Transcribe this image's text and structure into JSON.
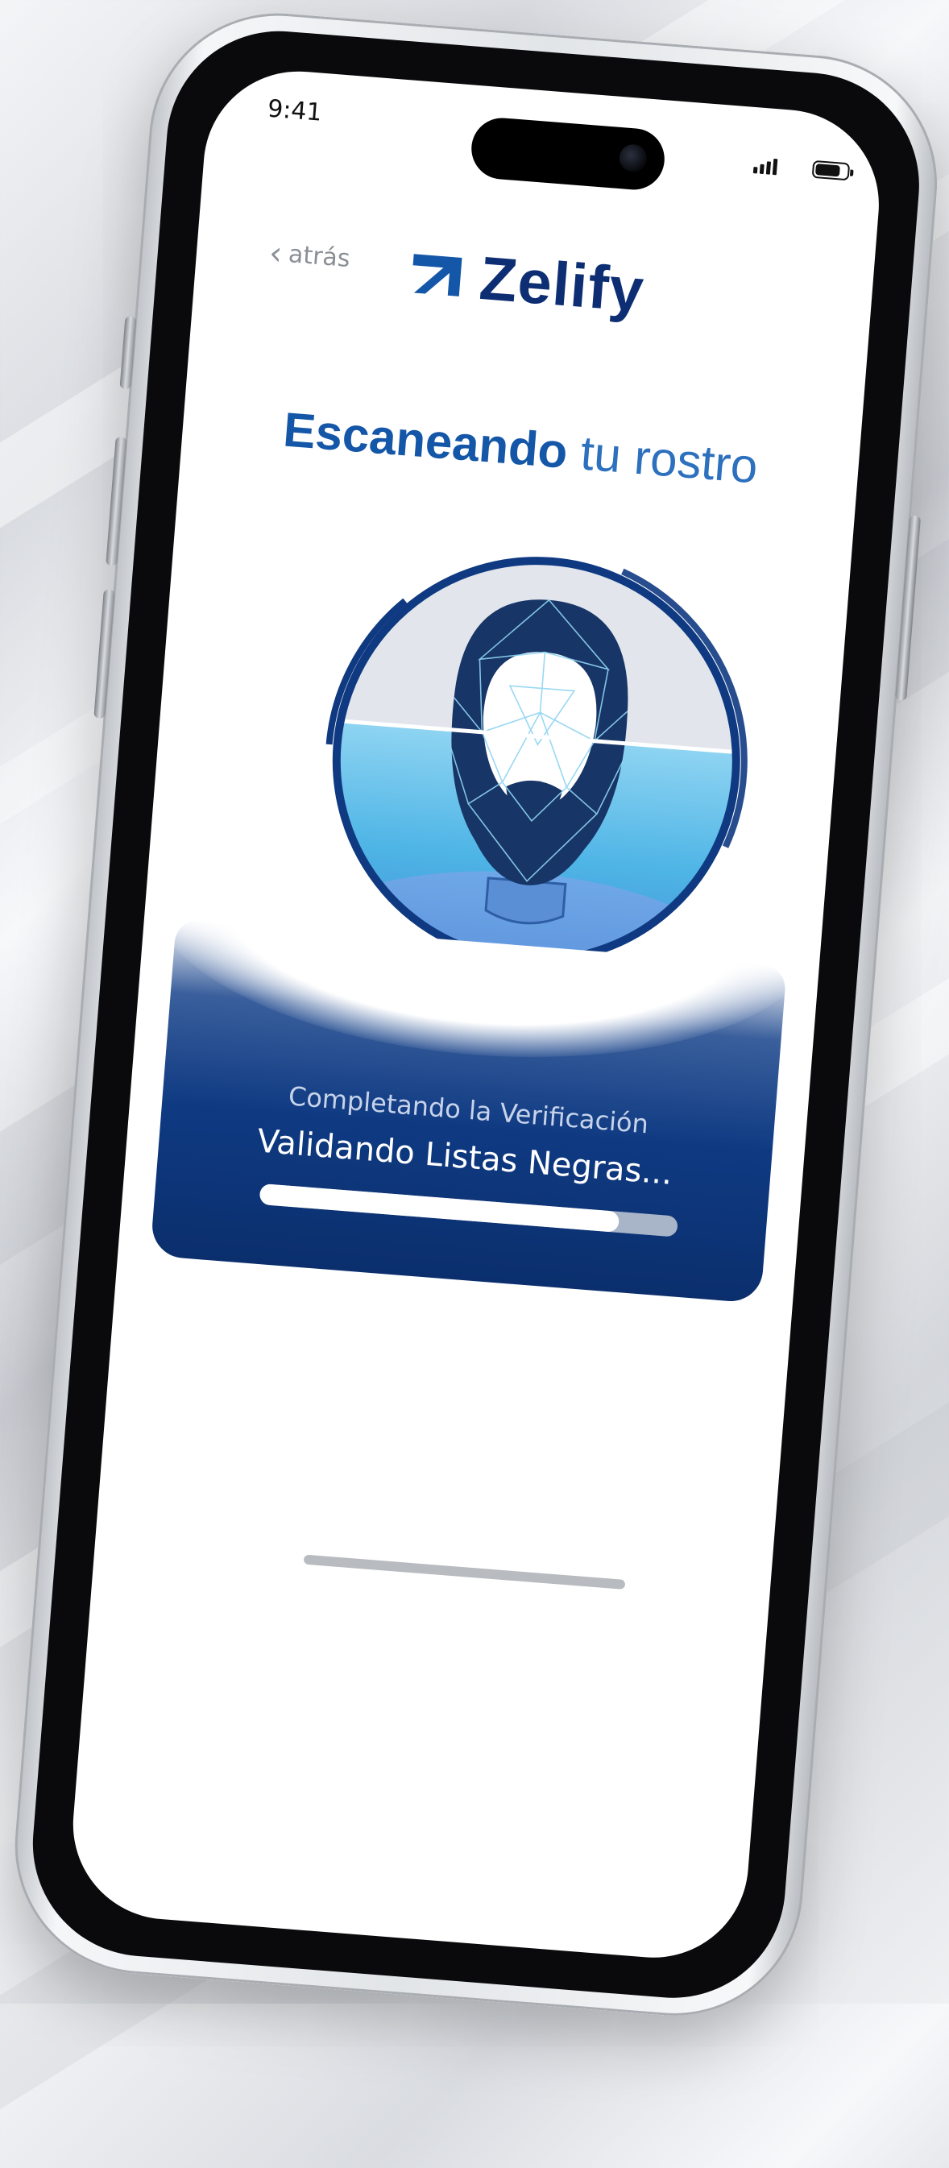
{
  "status_bar": {
    "time": "9:41"
  },
  "nav": {
    "back_label": "atrás"
  },
  "brand": {
    "name": "Zelify",
    "color": "#0d2e73"
  },
  "heading": {
    "bold": "Escaneando",
    "light": " tu rostro"
  },
  "verification": {
    "subtitle": "Completando la Verificación",
    "status": "Validando Listas Negras...",
    "progress_fraction": 0.86
  },
  "colors": {
    "accent": "#1456a7",
    "panel": "#0f3a82",
    "scan_ring": "#0f3a82",
    "scan_water": "#49b6e8"
  },
  "icons": {
    "back": "chevron-left-icon",
    "logo": "zelify-logo-icon"
  }
}
